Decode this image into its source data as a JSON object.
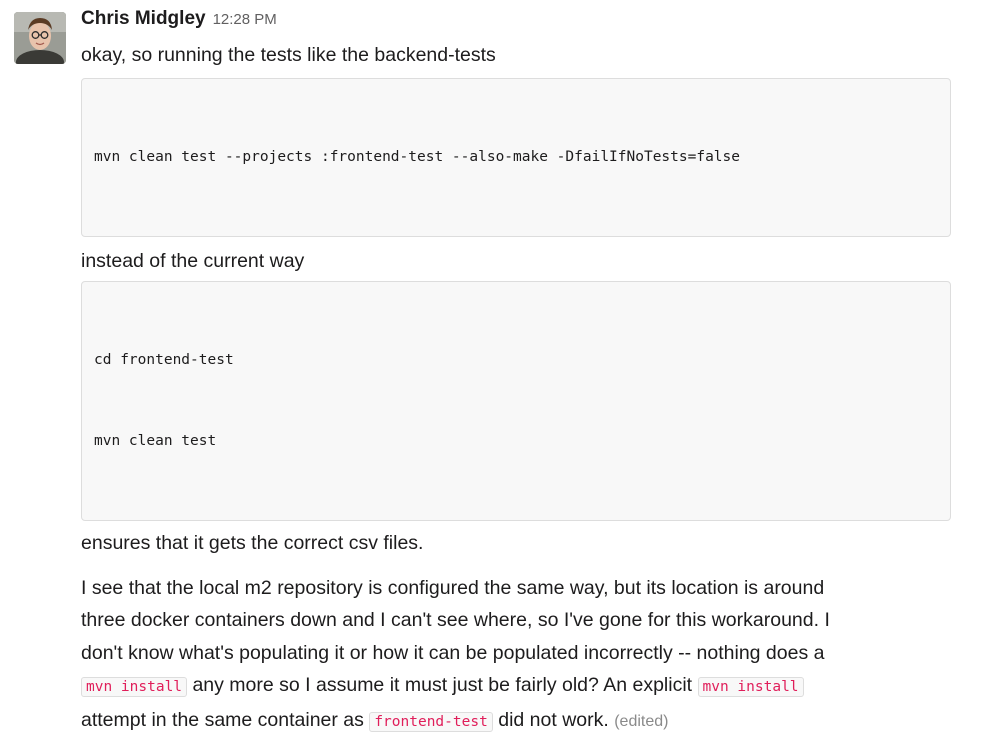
{
  "message": {
    "author": "Chris Midgley",
    "time": "12:28 PM",
    "para1": "okay, so running the tests like the backend-tests",
    "code1": "mvn clean test --projects :frontend-test --also-make -DfailIfNoTests=false",
    "para2": "instead of the current way",
    "code2_lines": [
      "cd frontend-test",
      "mvn clean test"
    ],
    "para3": "ensures that it gets the correct csv files.",
    "para4": {
      "line1": "I see that the local m2 repository is configured the same way, but its location is around",
      "line2": "three docker containers down and I can't see where, so I've gone for this workaround. I",
      "line3": "don't know what's populating it or how it can be populated incorrectly -- nothing does a",
      "code_a": "mvn install",
      "seg_a": " any more so I assume it must just be fairly old? An explicit ",
      "code_b": "mvn install",
      "seg_b": "attempt in the same container as ",
      "code_c": "frontend-test",
      "seg_c": " did not work. ",
      "edited": "(edited)"
    }
  }
}
